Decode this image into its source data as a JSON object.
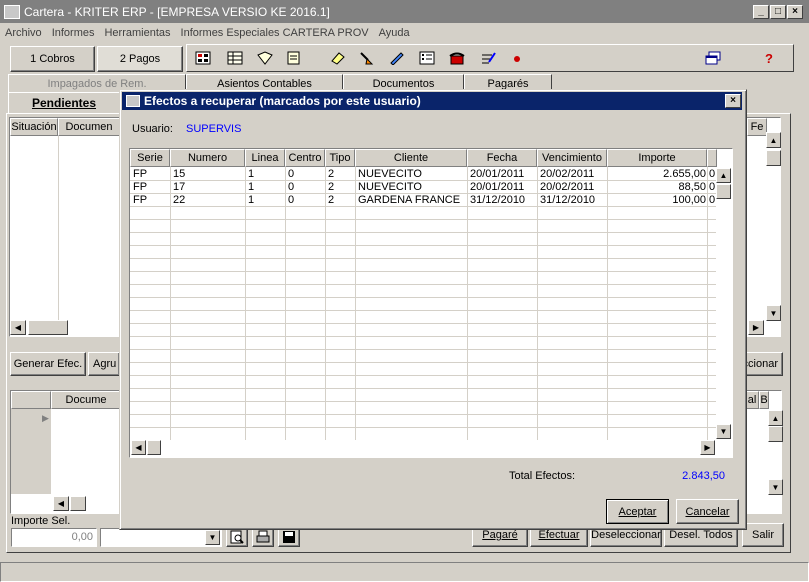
{
  "window": {
    "title": "Cartera - KRITER ERP - [EMPRESA VERSIO KE 2016.1]"
  },
  "menu": [
    "Archivo",
    "Informes",
    "Herramientas",
    "Informes Especiales CARTERA PROV",
    "Ayuda"
  ],
  "top_tabs": {
    "cobros": "1 Cobros",
    "pagos": "2 Pagos"
  },
  "sub_tabs": [
    "Impagados de Rem.",
    "Asientos Contables",
    "Documentos",
    "Pagarés"
  ],
  "tab_pendientes": "Pendientes",
  "bg_grid": {
    "col_situacion": "Situación",
    "col_documento": "Documen",
    "col_fe": "Fe"
  },
  "bg_buttons": {
    "generar": "Generar Efec.",
    "agrupar": "Agru",
    "seleccionar": "ccionar",
    "pagare": "Pagaré",
    "efectuar": "Efectuar",
    "deseleccionar": "Deseleccionar",
    "desel_todos": "Desel. Todos",
    "salir": "Salir"
  },
  "bg_grid2": {
    "col_documento": "Docume",
    "col_al": "al",
    "col_b": "B"
  },
  "importe_sel": {
    "label": "Importe Sel.",
    "value": "0,00"
  },
  "dialog": {
    "title": "Efectos a recuperar (marcados por este usuario)",
    "usuario_label": "Usuario:",
    "usuario_value": "SUPERVIS",
    "columns": [
      "Serie",
      "Numero",
      "Linea",
      "Centro",
      "Tipo",
      "Cliente",
      "Fecha",
      "Vencimiento",
      "Importe"
    ],
    "rows": [
      [
        "FP",
        "15",
        "1",
        "0",
        "2",
        "NUEVECITO",
        "20/01/2011",
        "20/02/2011",
        "2.655,00",
        "0"
      ],
      [
        "FP",
        "17",
        "1",
        "0",
        "2",
        "NUEVECITO",
        "20/01/2011",
        "20/02/2011",
        "88,50",
        "0"
      ],
      [
        "FP",
        "22",
        "1",
        "0",
        "2",
        "GARDENA FRANCE",
        "31/12/2010",
        "31/12/2010",
        "100,00",
        "0"
      ]
    ],
    "total_label": "Total Efectos:",
    "total_value": "2.843,50",
    "aceptar": "Aceptar",
    "cancelar": "Cancelar"
  },
  "colors": {
    "title_active": "#0a246a",
    "blue_text": "#0000ff",
    "window_bg": "#d4d0c8"
  }
}
